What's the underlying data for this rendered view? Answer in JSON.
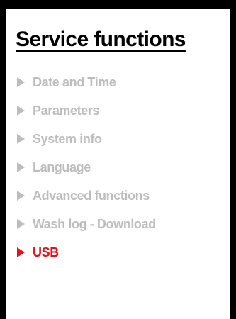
{
  "screen": {
    "title": "Service functions"
  },
  "menu": {
    "items": [
      {
        "label": "Date and Time",
        "icon": "triangle-right-icon",
        "active": false
      },
      {
        "label": "Parameters",
        "icon": "triangle-right-icon",
        "active": false
      },
      {
        "label": "System info",
        "icon": "triangle-right-icon",
        "active": false
      },
      {
        "label": "Language",
        "icon": "triangle-right-icon",
        "active": false
      },
      {
        "label": "Advanced functions",
        "icon": "triangle-right-icon",
        "active": false
      },
      {
        "label": "Wash log - Download",
        "icon": "triangle-right-icon",
        "active": false
      },
      {
        "label": "USB",
        "icon": "triangle-right-icon",
        "active": true
      }
    ]
  },
  "colors": {
    "frame": "#000000",
    "background": "#ffffff",
    "inactive_item": "#bdbdbd",
    "active_item": "#e3131b",
    "title": "#000000"
  }
}
